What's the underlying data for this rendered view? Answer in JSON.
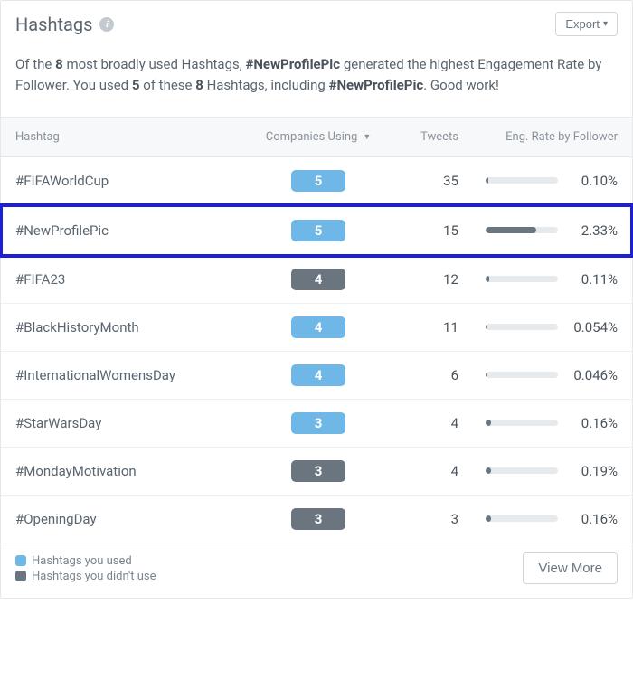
{
  "header": {
    "title": "Hashtags",
    "export_label": "Export"
  },
  "summary": {
    "prefix": "Of the ",
    "total_count": "8",
    "mid1": " most broadly used Hashtags, ",
    "top_hashtag": "#NewProfilePic",
    "mid2": " generated the highest Engagement Rate by Follower. You used ",
    "used_count": "5",
    "mid3": " of these ",
    "total_count2": "8",
    "mid4": " Hashtags, including ",
    "top_hashtag2": "#NewProfilePic",
    "tail": ". Good work!"
  },
  "columns": {
    "hashtag": "Hashtag",
    "companies": "Companies Using",
    "tweets": "Tweets",
    "eng": "Eng. Rate by Follower"
  },
  "rows": [
    {
      "hashtag": "#FIFAWorldCup",
      "companies": "5",
      "used": true,
      "tweets": "35",
      "eng": "0.10%",
      "bar_pct": 4,
      "highlight": false
    },
    {
      "hashtag": "#NewProfilePic",
      "companies": "5",
      "used": true,
      "tweets": "15",
      "eng": "2.33%",
      "bar_pct": 70,
      "highlight": true
    },
    {
      "hashtag": "#FIFA23",
      "companies": "4",
      "used": false,
      "tweets": "12",
      "eng": "0.11%",
      "bar_pct": 5,
      "highlight": false
    },
    {
      "hashtag": "#BlackHistoryMonth",
      "companies": "4",
      "used": true,
      "tweets": "11",
      "eng": "0.054%",
      "bar_pct": 2,
      "highlight": false
    },
    {
      "hashtag": "#InternationalWomensDay",
      "companies": "4",
      "used": true,
      "tweets": "6",
      "eng": "0.046%",
      "bar_pct": 2,
      "highlight": false
    },
    {
      "hashtag": "#StarWarsDay",
      "companies": "3",
      "used": true,
      "tweets": "4",
      "eng": "0.16%",
      "bar_pct": 7,
      "highlight": false
    },
    {
      "hashtag": "#MondayMotivation",
      "companies": "3",
      "used": false,
      "tweets": "4",
      "eng": "0.19%",
      "bar_pct": 8,
      "highlight": false
    },
    {
      "hashtag": "#OpeningDay",
      "companies": "3",
      "used": false,
      "tweets": "3",
      "eng": "0.16%",
      "bar_pct": 7,
      "highlight": false
    }
  ],
  "legend": {
    "used": "Hashtags you used",
    "notused": "Hashtags you didn't use"
  },
  "footer": {
    "view_more": "View More"
  },
  "chart_data": {
    "type": "table",
    "title": "Hashtags",
    "columns": [
      "Hashtag",
      "Companies Using",
      "Tweets",
      "Eng. Rate by Follower"
    ],
    "series": [
      {
        "name": "#FIFAWorldCup",
        "values": [
          5,
          35,
          0.1
        ]
      },
      {
        "name": "#NewProfilePic",
        "values": [
          5,
          15,
          2.33
        ]
      },
      {
        "name": "#FIFA23",
        "values": [
          4,
          12,
          0.11
        ]
      },
      {
        "name": "#BlackHistoryMonth",
        "values": [
          4,
          11,
          0.054
        ]
      },
      {
        "name": "#InternationalWomensDay",
        "values": [
          4,
          6,
          0.046
        ]
      },
      {
        "name": "#StarWarsDay",
        "values": [
          3,
          4,
          0.16
        ]
      },
      {
        "name": "#MondayMotivation",
        "values": [
          3,
          4,
          0.19
        ]
      },
      {
        "name": "#OpeningDay",
        "values": [
          3,
          3,
          0.16
        ]
      }
    ]
  }
}
